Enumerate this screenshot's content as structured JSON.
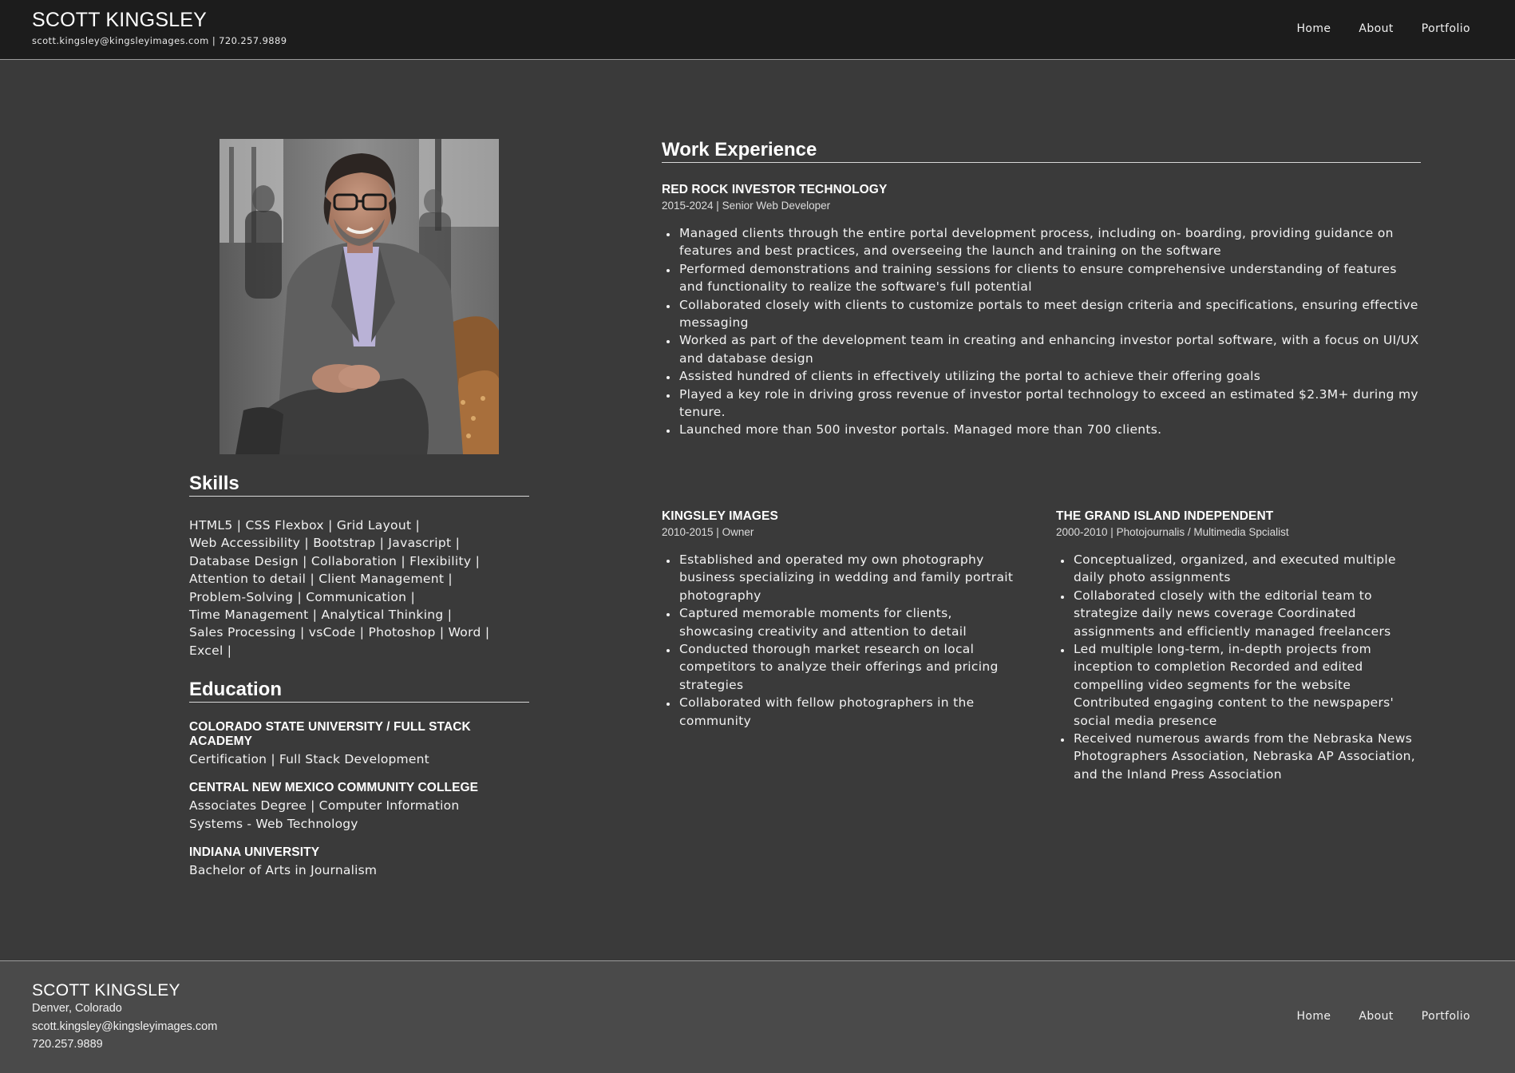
{
  "header": {
    "name": "SCOTT KINGSLEY",
    "contact": "scott.kingsley@kingsleyimages.com | 720.257.9889",
    "nav": [
      "Home",
      "About",
      "Portfolio"
    ]
  },
  "skills": {
    "title": "Skills",
    "items": [
      "HTML5",
      "CSS Flexbox",
      "Grid Layout",
      "Web Accessibility",
      "Bootstrap",
      "Javascript",
      "Database Design",
      "Collaboration",
      "Flexibility",
      "Attention to detail",
      "Client Management",
      "Problem-Solving",
      "Communication",
      "Time Management",
      "Analytical Thinking",
      "Sales Processing",
      "vsCode",
      "Photoshop",
      "Word",
      "Excel"
    ]
  },
  "education": {
    "title": "Education",
    "entries": [
      {
        "school": "COLORADO STATE UNIVERSITY / FULL STACK ACADEMY",
        "degree": "Certification | Full Stack Development"
      },
      {
        "school": "CENTRAL NEW MEXICO COMMUNITY COLLEGE",
        "degree": "Associates Degree | Computer Information Systems - Web Technology"
      },
      {
        "school": "INDIANA UNIVERSITY",
        "degree": "Bachelor of Arts in Journalism"
      }
    ]
  },
  "work": {
    "title": "Work Experience",
    "jobs": [
      {
        "company": "RED ROCK INVESTOR TECHNOLOGY",
        "meta": "2015-2024 | Senior Web Developer",
        "bullets": [
          "Managed clients through the entire portal development process, including on- boarding, providing guidance on features and best practices, and overseeing the launch and training on the software",
          "Performed demonstrations and training sessions for clients to ensure comprehensive understanding of features and functionality to realize the software's full potential",
          "Collaborated closely with clients to customize portals to meet design criteria and specifications, ensuring effective messaging",
          "Worked as part of the development team in creating and enhancing investor portal software, with a focus on UI/UX and database design",
          "Assisted hundred of clients in effectively utilizing the portal to achieve their offering goals",
          "Played a key role in driving gross revenue of investor portal technology to exceed an estimated $2.3M+ during my tenure.",
          "Launched more than 500 investor portals. Managed more than 700 clients."
        ]
      },
      {
        "company": "KINGSLEY IMAGES",
        "meta": "2010-2015 | Owner",
        "bullets": [
          "Established and operated my own photography business specializing in wedding and family portrait photography",
          "Captured memorable moments for clients, showcasing creativity and attention to detail",
          "Conducted thorough market research on local competitors to analyze their offerings and pricing strategies",
          "Collaborated with fellow photographers in the community"
        ]
      },
      {
        "company": "THE GRAND ISLAND INDEPENDENT",
        "meta": "2000-2010 | Photojournalis / Multimedia Spcialist",
        "bullets": [
          "Conceptualized, organized, and executed multiple daily photo assignments",
          "Collaborated closely with the editorial team to strategize daily news coverage Coordinated assignments and efficiently managed freelancers",
          "Led multiple long-term, in-depth projects from inception to completion Recorded and edited compelling video segments for the website Contributed engaging content to the newspapers' social media presence",
          "Received numerous awards from the Nebraska News Photographers Association, Nebraska AP Association, and the Inland Press Association"
        ]
      }
    ]
  },
  "footer": {
    "name": "SCOTT KINGSLEY",
    "location": "Denver, Colorado",
    "email": "scott.kingsley@kingsleyimages.com",
    "phone": "720.257.9889",
    "nav": [
      "Home",
      "About",
      "Portfolio"
    ]
  }
}
